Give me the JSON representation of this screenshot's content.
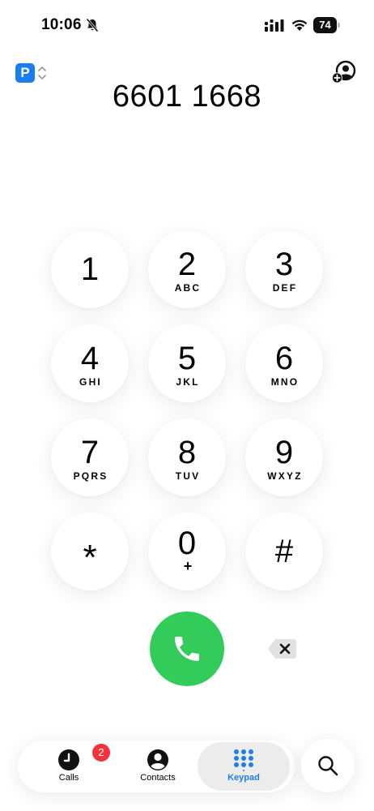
{
  "status_bar": {
    "time": "10:06",
    "battery_level": "74",
    "icons": [
      "bell-slash-icon",
      "cellular-signal-icon",
      "wifi-icon",
      "battery-icon"
    ]
  },
  "header": {
    "profile_letter": "P",
    "profile_color": "#1a7df0",
    "dialed_number": "6601 1668"
  },
  "keypad": {
    "keys": [
      {
        "digit": "1",
        "letters": ""
      },
      {
        "digit": "2",
        "letters": "ABC"
      },
      {
        "digit": "3",
        "letters": "DEF"
      },
      {
        "digit": "4",
        "letters": "GHI"
      },
      {
        "digit": "5",
        "letters": "JKL"
      },
      {
        "digit": "6",
        "letters": "MNO"
      },
      {
        "digit": "7",
        "letters": "PQRS"
      },
      {
        "digit": "8",
        "letters": "TUV"
      },
      {
        "digit": "9",
        "letters": "WXYZ"
      },
      {
        "digit": "*",
        "letters": ""
      },
      {
        "digit": "0",
        "letters": "+"
      },
      {
        "digit": "#",
        "letters": ""
      }
    ],
    "call_color": "#33cc5a"
  },
  "tab_bar": {
    "tabs": [
      {
        "label": "Calls",
        "badge": "2",
        "icon": "clock-icon"
      },
      {
        "label": "Contacts",
        "icon": "person-circle-icon"
      },
      {
        "label": "Keypad",
        "icon": "keypad-grid-icon",
        "active": true
      }
    ],
    "active_color": "#1f7fe6",
    "badge_color": "#f0333c"
  },
  "search": {
    "icon": "magnifier-icon"
  }
}
